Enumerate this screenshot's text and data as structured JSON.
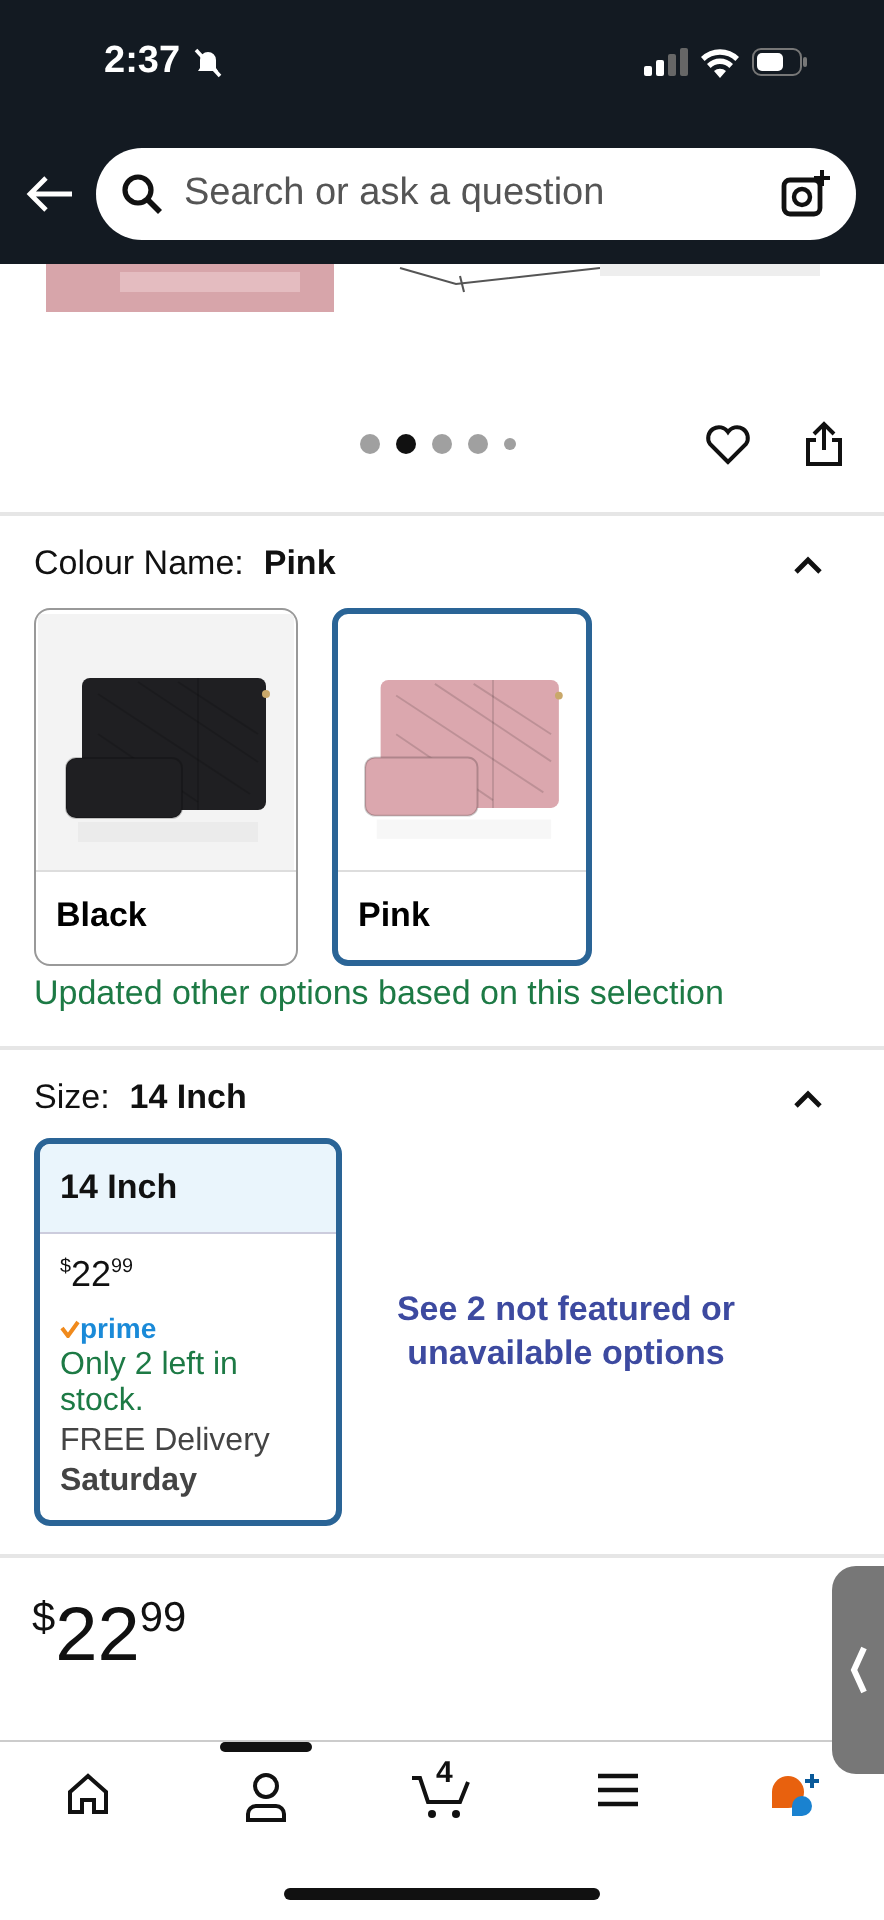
{
  "status_bar": {
    "time": "2:37",
    "silent": true
  },
  "search": {
    "placeholder": "Search or ask a question"
  },
  "gallery": {
    "kind": "picture",
    "dots": [
      {
        "selected": false
      },
      {
        "selected": true
      },
      {
        "selected": false
      },
      {
        "selected": false
      },
      {
        "selected": false
      }
    ]
  },
  "colour": {
    "label": "Colour Name:",
    "value": "Pink",
    "expanded": true,
    "options": [
      {
        "name": "Black",
        "selected": false,
        "color": "#1f1f22"
      },
      {
        "name": "Pink",
        "selected": true,
        "color": "#dba7ae"
      }
    ],
    "note": "Updated other options based on this selection"
  },
  "size": {
    "label": "Size:",
    "value": "14 Inch",
    "expanded": true,
    "options": [
      {
        "name": "14 Inch",
        "selected": true,
        "price_symbol": "$",
        "price_whole": "22",
        "price_fraction": "99",
        "prime": "prime",
        "stock": "Only 2 left in stock.",
        "delivery": "FREE Delivery",
        "delivery_day": "Saturday"
      }
    ],
    "more_link": "See 2 not featured or unavailable options"
  },
  "price": {
    "symbol": "$",
    "whole": "22",
    "fraction": "99"
  },
  "nav": [
    {
      "kind": "home",
      "selected": false
    },
    {
      "kind": "account",
      "selected": true
    },
    {
      "kind": "cart",
      "selected": false,
      "badge": "4"
    },
    {
      "kind": "menu",
      "selected": false
    },
    {
      "kind": "assistant",
      "selected": false
    }
  ]
}
